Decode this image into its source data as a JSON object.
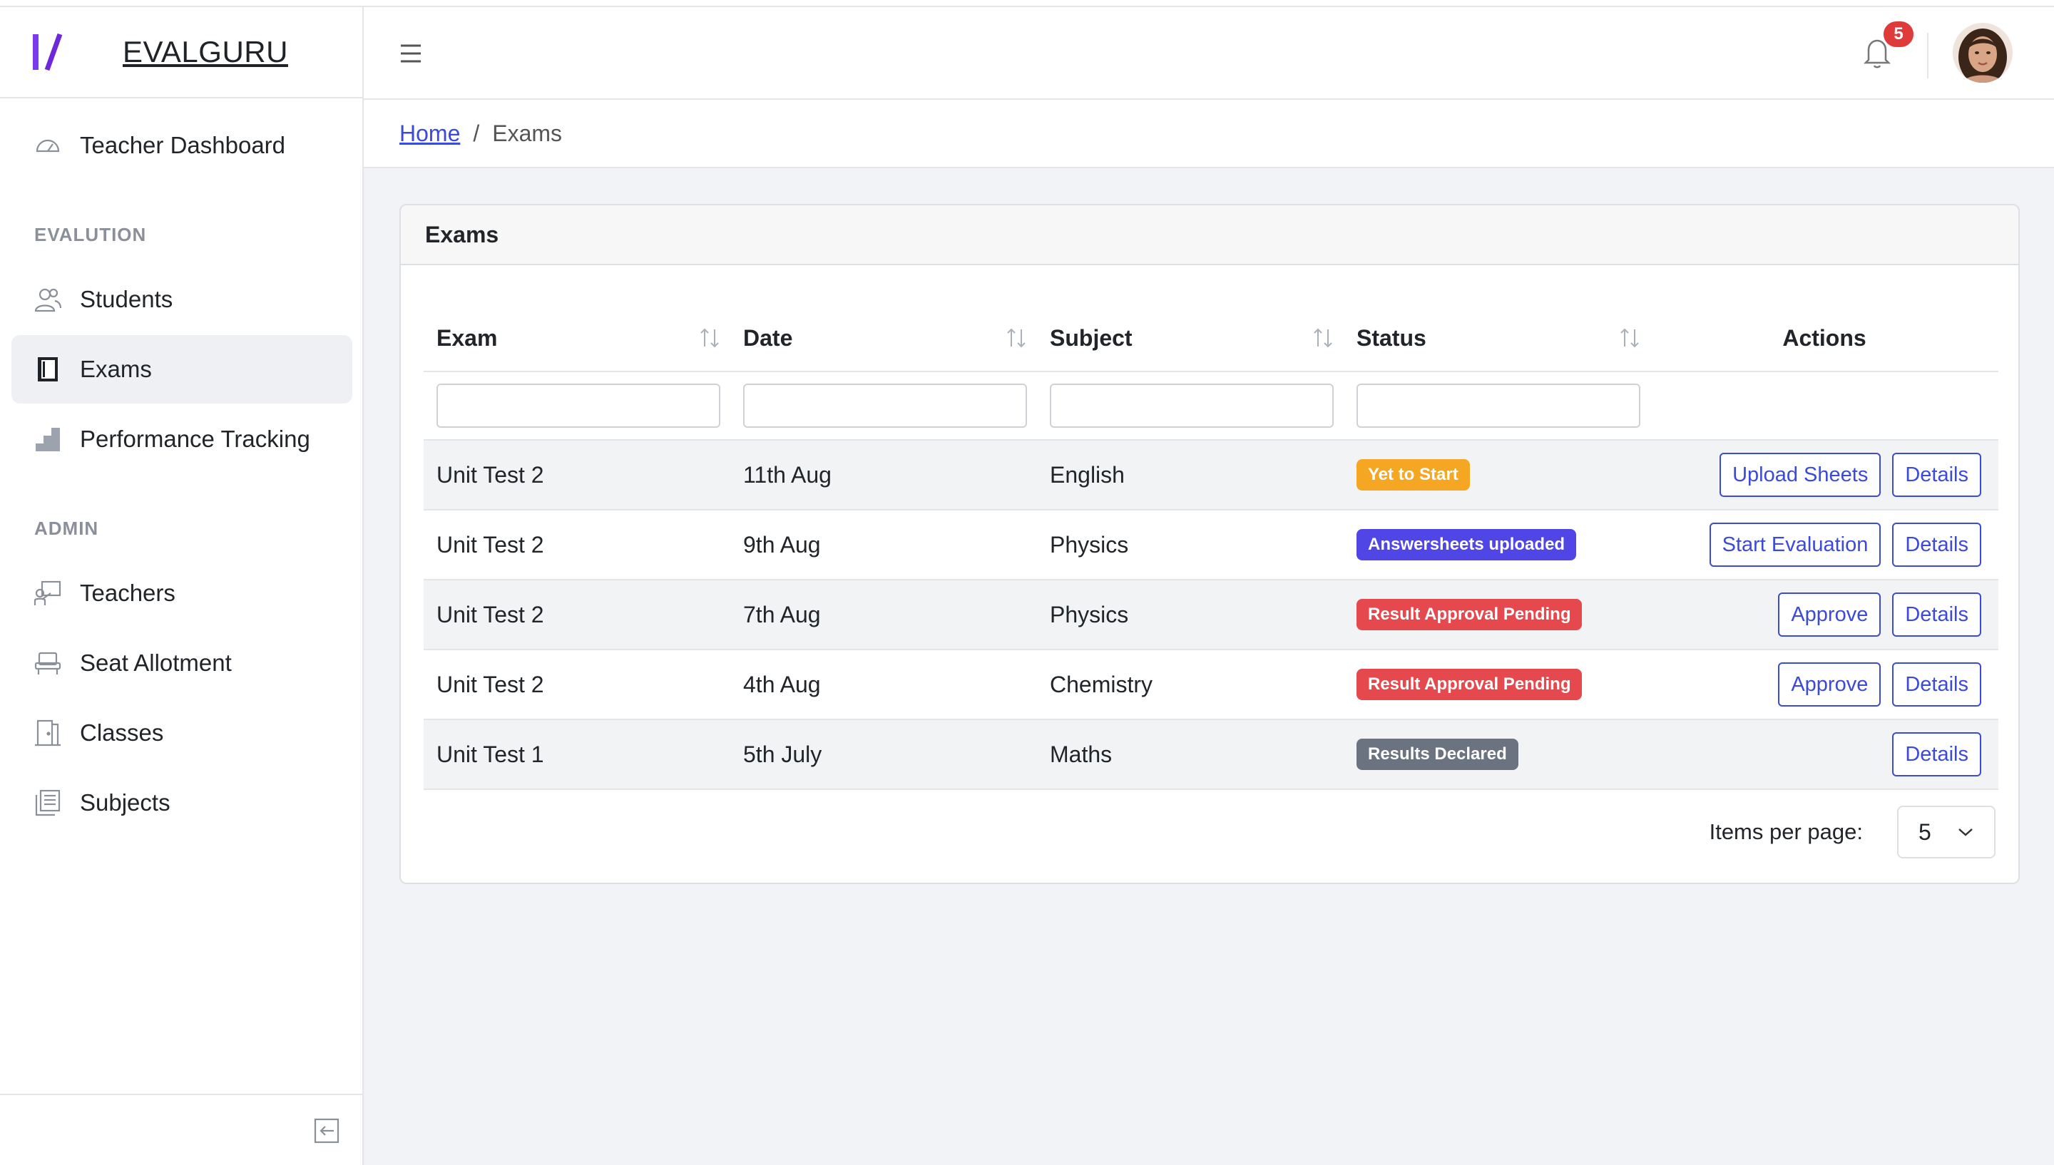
{
  "brand": {
    "name": "EVALGURU"
  },
  "sidebar": {
    "dashboard": "Teacher Dashboard",
    "sections": [
      {
        "label": "EVALUTION",
        "items": [
          "Students",
          "Exams",
          "Performance Tracking"
        ]
      },
      {
        "label": "ADMIN",
        "items": [
          "Teachers",
          "Seat Allotment",
          "Classes",
          "Subjects"
        ]
      }
    ],
    "active": "Exams"
  },
  "header": {
    "notification_count": "5"
  },
  "breadcrumb": {
    "home": "Home",
    "current": "Exams"
  },
  "card": {
    "title": "Exams"
  },
  "table": {
    "columns": [
      "Exam",
      "Date",
      "Subject",
      "Status",
      "Actions"
    ],
    "rows": [
      {
        "exam": "Unit Test 2",
        "date": "11th Aug",
        "subject": "English",
        "status": "Yet to Start",
        "actions": [
          "Upload Sheets",
          "Details"
        ]
      },
      {
        "exam": "Unit Test 2",
        "date": "9th Aug",
        "subject": "Physics",
        "status": "Answersheets uploaded",
        "actions": [
          "Start Evaluation",
          "Details"
        ]
      },
      {
        "exam": "Unit Test 2",
        "date": "7th Aug",
        "subject": "Physics",
        "status": "Result Approval Pending",
        "actions": [
          "Approve",
          "Details"
        ]
      },
      {
        "exam": "Unit Test 2",
        "date": "4th Aug",
        "subject": "Chemistry",
        "status": "Result Approval Pending",
        "actions": [
          "Approve",
          "Details"
        ]
      },
      {
        "exam": "Unit Test 1",
        "date": "5th July",
        "subject": "Maths",
        "status": "Results Declared",
        "actions": [
          "Details"
        ]
      }
    ]
  },
  "pagination": {
    "label": "Items per page:",
    "value": "5"
  },
  "colors": {
    "accent": "#3b4ad8",
    "status_yet": "#f5a623",
    "status_uploaded": "#4f46e5",
    "status_pending": "#e5484d",
    "status_declared": "#6b7280",
    "badge": "#e03b3b"
  }
}
